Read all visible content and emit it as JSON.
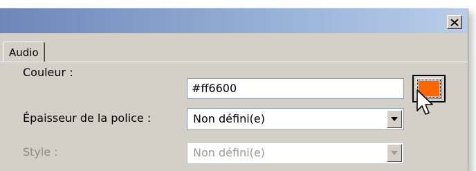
{
  "window": {
    "close_icon": "close-icon"
  },
  "tabs": [
    {
      "label": "Audio"
    }
  ],
  "form": {
    "color": {
      "label": "Couleur :",
      "value": "#ff6600",
      "swatch_color": "#ff6600"
    },
    "font_weight": {
      "label": "Épaisseur de la police :",
      "selected": "Non défini(e)"
    },
    "style": {
      "label": "Style :",
      "selected": "Non défini(e)"
    }
  },
  "colors": {
    "title_gradient_start": "#6f86b8",
    "title_gradient_end": "#b9cdea",
    "panel_background": "#d4d0c8",
    "field_border": "#7f9db9",
    "disabled_text": "#8a8a8a"
  }
}
